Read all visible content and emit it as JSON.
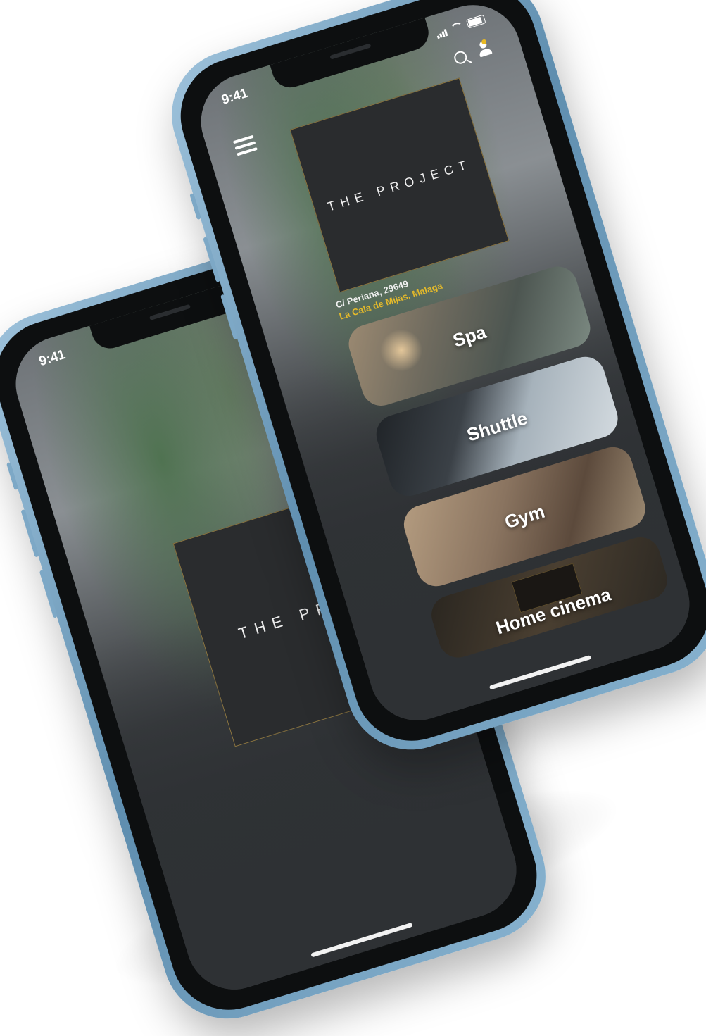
{
  "back_phone": {
    "status_time": "9:41",
    "logo_text": "THE PRO"
  },
  "front_phone": {
    "status_time": "9:41",
    "logo_text": "THE PROJECT",
    "address": {
      "street": "C/ Periana, 29649",
      "city": "La Cala de Mijas, Malaga"
    },
    "cards": [
      {
        "label": "Spa"
      },
      {
        "label": "Shuttle"
      },
      {
        "label": "Gym"
      },
      {
        "label": "Home cinema"
      }
    ]
  },
  "colors": {
    "accent": "#e3b92b",
    "screen_bg": "#2e3134",
    "frame": "#7da8c6"
  }
}
